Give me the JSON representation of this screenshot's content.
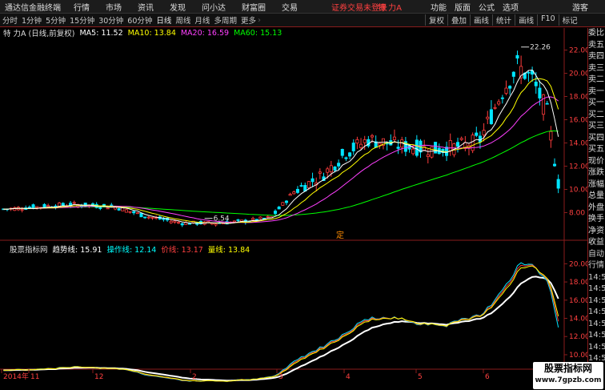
{
  "app": {
    "title": "通达信金融终端",
    "menus": [
      "行情",
      "市场",
      "资讯",
      "发现",
      "问小达",
      "财富圈",
      "交易"
    ],
    "notice": "证券交易未登录",
    "stock_name": "特 力A",
    "right_menu": [
      "功能",
      "版面",
      "公式",
      "选项"
    ],
    "guest": "游客"
  },
  "toolbar": {
    "periods": [
      "分时",
      "1分钟",
      "5分钟",
      "15分钟",
      "30分钟",
      "60分钟",
      "日线",
      "周线",
      "月线",
      "多周期",
      "更多"
    ],
    "active_period": "日线",
    "tools": [
      "复权",
      "叠加",
      "画线",
      "统计",
      "画线",
      "F10",
      "标记"
    ]
  },
  "main_info": {
    "name": "特 力A (日线,前复权)",
    "items": [
      {
        "label": "MA5: 11.52",
        "color": "#ffffff"
      },
      {
        "label": "MA10: 13.84",
        "color": "#ffff00"
      },
      {
        "label": "MA20: 16.59",
        "color": "#ff40ff"
      },
      {
        "label": "MA60: 15.13",
        "color": "#00ff00"
      }
    ]
  },
  "ind_info": {
    "name": "股票指标网",
    "items": [
      {
        "label": "趋势线: 15.91",
        "color": "#ffffff"
      },
      {
        "label": "操作线: 12.14",
        "color": "#00ffff"
      },
      {
        "label": "价线: 13.17",
        "color": "#ff4040"
      },
      {
        "label": "量线: 13.84",
        "color": "#ffff00"
      }
    ]
  },
  "price_axis": [
    "22.00",
    "20.00",
    "18.00",
    "16.00",
    "14.00",
    "12.00",
    "10.00",
    "8.00"
  ],
  "ind_axis": [
    "20.00",
    "18.00",
    "16.00",
    "14.00",
    "12.00",
    "10.00"
  ],
  "date_axis": [
    "2014年",
    "11",
    "12",
    "2",
    "3",
    "4",
    "5",
    "6"
  ],
  "annotations": {
    "high": "22.26",
    "low": "6.54",
    "marker": "定"
  },
  "quote_panel": [
    "委比",
    "卖五",
    "卖四",
    "卖三",
    "卖二",
    "卖一",
    "买一",
    "买二",
    "买三",
    "买四",
    "买五",
    "现价",
    "涨跌",
    "涨幅",
    "总量",
    "外盘",
    "换手",
    "净资",
    "收益",
    "",
    "自动",
    "行情",
    "14:5",
    "14:5",
    "14:5",
    "14:5",
    "14:5",
    "14:5",
    "14:5",
    "14:5"
  ],
  "watermark": {
    "line1": "股票指标网",
    "line2": "www.7gpzb.com"
  },
  "colors": {
    "up": "#ff3c3c",
    "down": "#00e5ff",
    "ma5": "#ffffff",
    "ma10": "#ffff00",
    "ma20": "#ff40ff",
    "ma60": "#00ff00",
    "grid": "#8a1c1c",
    "axis_text": "#ff4040"
  }
}
